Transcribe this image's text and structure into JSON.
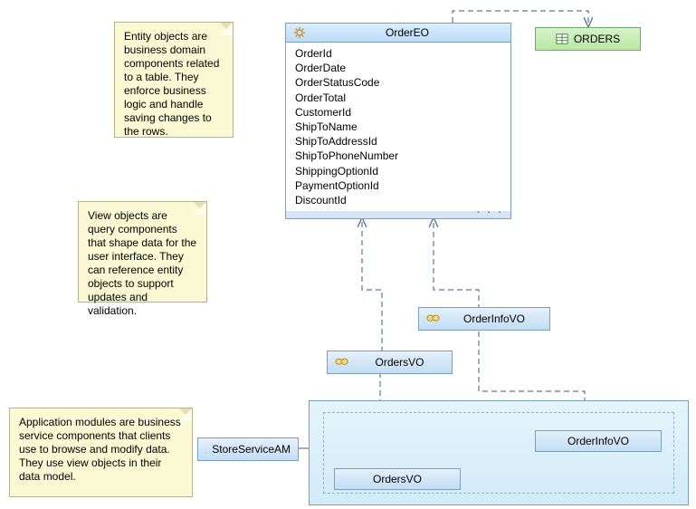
{
  "notes": {
    "entity": "Entity objects are business domain components related to a table. They enforce business logic and handle saving changes to the rows.",
    "view": "View objects are query components that shape data for the user interface. They can reference entity objects to support updates and validation.",
    "appmodule": "Application modules are business service components that clients use to browse and modify data. They use view objects in their data model."
  },
  "entity": {
    "name": "OrderEO",
    "attributes": [
      "OrderId",
      "OrderDate",
      "OrderStatusCode",
      "OrderTotal",
      "CustomerId",
      "ShipToName",
      "ShipToAddressId",
      "ShipToPhoneNumber",
      "ShippingOptionId",
      "PaymentOptionId",
      "DiscountId"
    ],
    "more": ". . ."
  },
  "table": {
    "name": "ORDERS"
  },
  "viewObjects": {
    "ordersVO": "OrdersVO",
    "orderInfoVO": "OrderInfoVO"
  },
  "appModule": {
    "name": "StoreServiceAM",
    "usages": {
      "ordersVO": "OrdersVO",
      "orderInfoVO": "OrderInfoVO"
    }
  }
}
